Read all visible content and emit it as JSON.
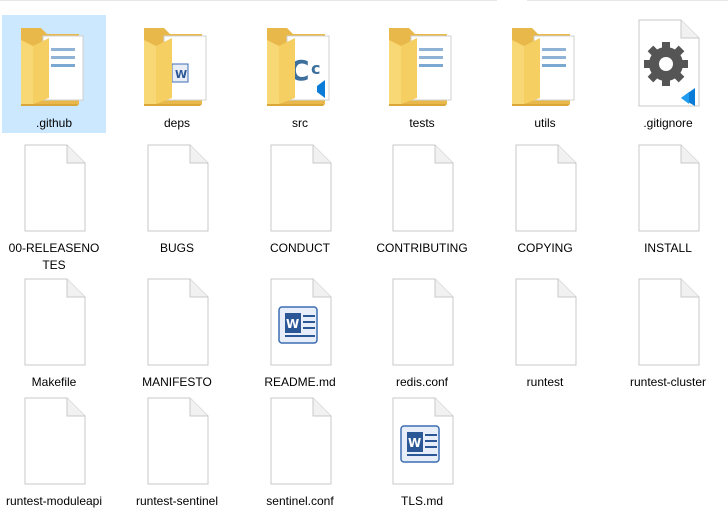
{
  "window": {
    "view": "Large icons"
  },
  "colors": {
    "selection": "#cce8ff",
    "folder": "#f8d775",
    "folder_dark": "#e8b84a",
    "vscode_blue": "#0a7bd6"
  },
  "files": [
    {
      "name": ".github",
      "icon": "folder-icon",
      "selected": true
    },
    {
      "name": "deps",
      "icon": "folder-word-icon",
      "selected": false
    },
    {
      "name": "src",
      "icon": "folder-c-icon",
      "selected": false
    },
    {
      "name": "tests",
      "icon": "folder-icon",
      "selected": false
    },
    {
      "name": "utils",
      "icon": "folder-icon",
      "selected": false
    },
    {
      "name": ".gitignore",
      "icon": "vscode-gear-file-icon",
      "selected": false
    },
    {
      "name": "00-RELEASENOTES",
      "icon": "blank-file-icon",
      "selected": false
    },
    {
      "name": "BUGS",
      "icon": "blank-file-icon",
      "selected": false
    },
    {
      "name": "CONDUCT",
      "icon": "blank-file-icon",
      "selected": false
    },
    {
      "name": "CONTRIBUTING",
      "icon": "blank-file-icon",
      "selected": false
    },
    {
      "name": "COPYING",
      "icon": "blank-file-icon",
      "selected": false
    },
    {
      "name": "INSTALL",
      "icon": "blank-file-icon",
      "selected": false
    },
    {
      "name": "Makefile",
      "icon": "blank-file-icon",
      "selected": false
    },
    {
      "name": "MANIFESTO",
      "icon": "blank-file-icon",
      "selected": false
    },
    {
      "name": "README.md",
      "icon": "word-document-icon",
      "selected": false
    },
    {
      "name": "redis.conf",
      "icon": "blank-file-icon",
      "selected": false
    },
    {
      "name": "runtest",
      "icon": "blank-file-icon",
      "selected": false
    },
    {
      "name": "runtest-cluster",
      "icon": "blank-file-icon",
      "selected": false
    },
    {
      "name": "runtest-moduleapi",
      "icon": "blank-file-icon",
      "selected": false
    },
    {
      "name": "runtest-sentinel",
      "icon": "blank-file-icon",
      "selected": false
    },
    {
      "name": "sentinel.conf",
      "icon": "blank-file-icon",
      "selected": false
    },
    {
      "name": "TLS.md",
      "icon": "word-document-icon",
      "selected": false
    }
  ]
}
